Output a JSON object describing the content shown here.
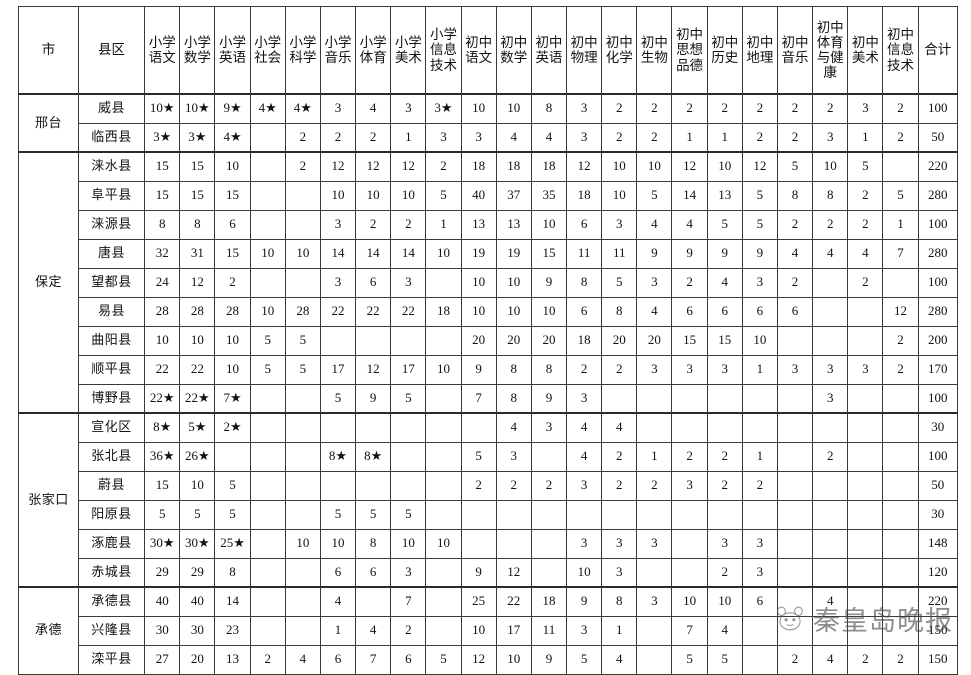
{
  "table": {
    "title": "",
    "headers": {
      "city": "市",
      "county": "县区",
      "total": "合计",
      "subjects": [
        "小学语文",
        "小学数学",
        "小学英语",
        "小学社会",
        "小学科学",
        "小学音乐",
        "小学体育",
        "小学美术",
        "小学信息技术",
        "初中语文",
        "初中数学",
        "初中英语",
        "初中物理",
        "初中化学",
        "初中生物",
        "初中思想品德",
        "初中历史",
        "初中地理",
        "初中音乐",
        "初中体育与健康",
        "初中美术",
        "初中信息技术"
      ]
    },
    "groups": [
      {
        "city": "邢台",
        "rows": [
          {
            "county": "威县",
            "values": [
              "10★",
              "10★",
              "9★",
              "4★",
              "4★",
              "3",
              "4",
              "3",
              "3★",
              "10",
              "10",
              "8",
              "3",
              "2",
              "2",
              "2",
              "2",
              "2",
              "2",
              "2",
              "3",
              "2"
            ],
            "total": "100"
          },
          {
            "county": "临西县",
            "values": [
              "3★",
              "3★",
              "4★",
              "",
              "2",
              "2",
              "2",
              "1",
              "3",
              "3",
              "4",
              "4",
              "3",
              "2",
              "2",
              "1",
              "1",
              "2",
              "2",
              "3",
              "1",
              "2"
            ],
            "total": "50"
          }
        ]
      },
      {
        "city": "保定",
        "rows": [
          {
            "county": "涞水县",
            "values": [
              "15",
              "15",
              "10",
              "",
              "2",
              "12",
              "12",
              "12",
              "2",
              "18",
              "18",
              "18",
              "12",
              "10",
              "10",
              "12",
              "10",
              "12",
              "5",
              "10",
              "5",
              ""
            ],
            "total": "220"
          },
          {
            "county": "阜平县",
            "values": [
              "15",
              "15",
              "15",
              "",
              "",
              "10",
              "10",
              "10",
              "5",
              "40",
              "37",
              "35",
              "18",
              "10",
              "5",
              "14",
              "13",
              "5",
              "8",
              "8",
              "2",
              "5"
            ],
            "total": "280"
          },
          {
            "county": "涞源县",
            "values": [
              "8",
              "8",
              "6",
              "",
              "",
              "3",
              "2",
              "2",
              "1",
              "13",
              "13",
              "10",
              "6",
              "3",
              "4",
              "4",
              "5",
              "5",
              "2",
              "2",
              "2",
              "1"
            ],
            "total": "100"
          },
          {
            "county": "唐县",
            "values": [
              "32",
              "31",
              "15",
              "10",
              "10",
              "14",
              "14",
              "14",
              "10",
              "19",
              "19",
              "15",
              "11",
              "11",
              "9",
              "9",
              "9",
              "9",
              "4",
              "4",
              "4",
              "7"
            ],
            "total": "280"
          },
          {
            "county": "望都县",
            "values": [
              "24",
              "12",
              "2",
              "",
              "",
              "3",
              "6",
              "3",
              "",
              "10",
              "10",
              "9",
              "8",
              "5",
              "3",
              "2",
              "4",
              "3",
              "2",
              "",
              "2",
              ""
            ],
            "total": "100"
          },
          {
            "county": "易县",
            "values": [
              "28",
              "28",
              "28",
              "10",
              "28",
              "22",
              "22",
              "22",
              "18",
              "10",
              "10",
              "10",
              "6",
              "8",
              "4",
              "6",
              "6",
              "6",
              "6",
              "",
              "",
              "12"
            ],
            "total": "280"
          },
          {
            "county": "曲阳县",
            "values": [
              "10",
              "10",
              "10",
              "5",
              "5",
              "",
              "",
              "",
              "",
              "20",
              "20",
              "20",
              "18",
              "20",
              "20",
              "15",
              "15",
              "10",
              "",
              "",
              "",
              "2"
            ],
            "total": "200"
          },
          {
            "county": "顺平县",
            "values": [
              "22",
              "22",
              "10",
              "5",
              "5",
              "17",
              "12",
              "17",
              "10",
              "9",
              "8",
              "8",
              "2",
              "2",
              "3",
              "3",
              "3",
              "1",
              "3",
              "3",
              "3",
              "2"
            ],
            "total": "170"
          },
          {
            "county": "博野县",
            "values": [
              "22★",
              "22★",
              "7★",
              "",
              "",
              "5",
              "9",
              "5",
              "",
              "7",
              "8",
              "9",
              "3",
              "",
              "",
              "",
              "",
              "",
              "",
              "3",
              "",
              ""
            ],
            "total": "100"
          }
        ]
      },
      {
        "city": "张家口",
        "rows": [
          {
            "county": "宣化区",
            "values": [
              "8★",
              "5★",
              "2★",
              "",
              "",
              "",
              "",
              "",
              "",
              "",
              "4",
              "3",
              "4",
              "4",
              "",
              "",
              "",
              "",
              "",
              "",
              "",
              ""
            ],
            "total": "30"
          },
          {
            "county": "张北县",
            "values": [
              "36★",
              "26★",
              "",
              "",
              "",
              "8★",
              "8★",
              "",
              "",
              "5",
              "3",
              "",
              "4",
              "2",
              "1",
              "2",
              "2",
              "1",
              "",
              "2",
              "",
              ""
            ],
            "total": "100"
          },
          {
            "county": "蔚县",
            "values": [
              "15",
              "10",
              "5",
              "",
              "",
              "",
              "",
              "",
              "",
              "2",
              "2",
              "2",
              "3",
              "2",
              "2",
              "3",
              "2",
              "2",
              "",
              "",
              "",
              ""
            ],
            "total": "50"
          },
          {
            "county": "阳原县",
            "values": [
              "5",
              "5",
              "5",
              "",
              "",
              "5",
              "5",
              "5",
              "",
              "",
              "",
              "",
              "",
              "",
              "",
              "",
              "",
              "",
              "",
              "",
              "",
              ""
            ],
            "total": "30"
          },
          {
            "county": "涿鹿县",
            "values": [
              "30★",
              "30★",
              "25★",
              "",
              "10",
              "10",
              "8",
              "10",
              "10",
              "",
              "",
              "",
              "3",
              "3",
              "3",
              "",
              "3",
              "3",
              "",
              "",
              "",
              ""
            ],
            "total": "148"
          },
          {
            "county": "赤城县",
            "values": [
              "29",
              "29",
              "8",
              "",
              "",
              "6",
              "6",
              "3",
              "",
              "9",
              "12",
              "",
              "10",
              "3",
              "",
              "",
              "2",
              "3",
              "",
              "",
              "",
              ""
            ],
            "total": "120"
          }
        ]
      },
      {
        "city": "承德",
        "rows": [
          {
            "county": "承德县",
            "values": [
              "40",
              "40",
              "14",
              "",
              "",
              "4",
              "",
              "7",
              "",
              "25",
              "22",
              "18",
              "9",
              "8",
              "3",
              "10",
              "10",
              "6",
              "",
              "4",
              "",
              ""
            ],
            "total": "220"
          },
          {
            "county": "兴隆县",
            "values": [
              "30",
              "30",
              "23",
              "",
              "",
              "1",
              "4",
              "2",
              "",
              "10",
              "17",
              "11",
              "3",
              "1",
              "",
              "7",
              "4",
              "",
              "",
              "",
              "",
              ""
            ],
            "total": "150"
          },
          {
            "county": "滦平县",
            "values": [
              "27",
              "20",
              "13",
              "2",
              "4",
              "6",
              "7",
              "6",
              "5",
              "12",
              "10",
              "9",
              "5",
              "4",
              "",
              "5",
              "5",
              "",
              "2",
              "4",
              "2",
              "2"
            ],
            "total": "150"
          }
        ]
      }
    ]
  },
  "watermark": {
    "text": "秦皇岛晚报",
    "logo": "panda-logo-icon"
  },
  "layout": {
    "col_widths": {
      "city": 58,
      "county": 64,
      "subject": 34,
      "total": 38
    }
  }
}
